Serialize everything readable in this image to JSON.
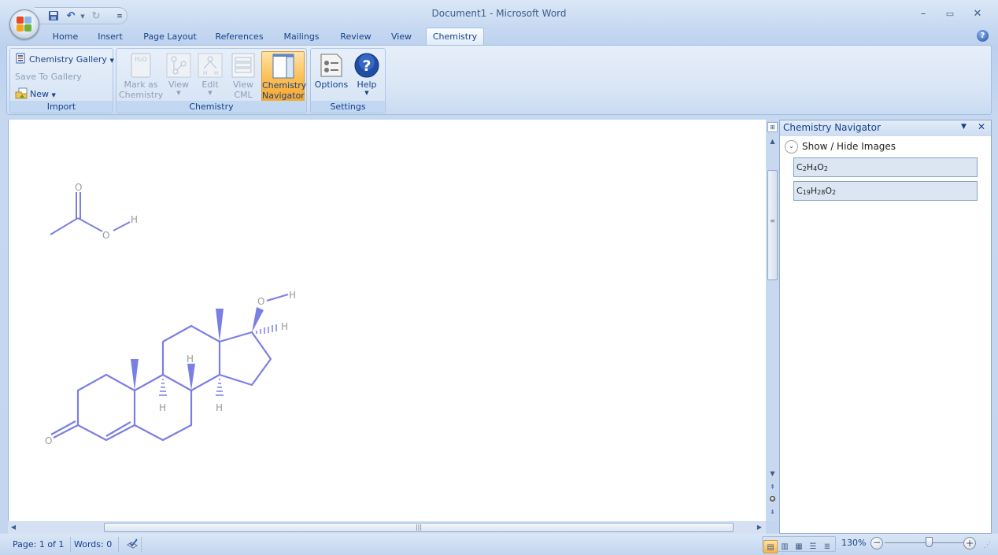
{
  "window": {
    "title": "Document1 - Microsoft Word",
    "controls": {
      "minimize": "–",
      "maximize": "▭",
      "close": "✕"
    }
  },
  "quick_access": {
    "save_icon": "save-icon",
    "undo_icon": "undo-icon",
    "redo_icon": "redo-icon",
    "customize_icon": "customize-icon"
  },
  "tabs": [
    {
      "label": "Home",
      "active": false
    },
    {
      "label": "Insert",
      "active": false
    },
    {
      "label": "Page Layout",
      "active": false
    },
    {
      "label": "References",
      "active": false
    },
    {
      "label": "Mailings",
      "active": false
    },
    {
      "label": "Review",
      "active": false
    },
    {
      "label": "View",
      "active": false
    },
    {
      "label": "Chemistry",
      "active": true
    }
  ],
  "ribbon": {
    "groups": {
      "import": {
        "label": "Import",
        "chemistry_gallery": "Chemistry Gallery",
        "save_to_gallery": "Save To Gallery",
        "new": "New"
      },
      "chemistry": {
        "label": "Chemistry",
        "mark_as": "Mark as",
        "mark_as_2": "Chemistry",
        "view": "View",
        "edit": "Edit",
        "view_cml": "View",
        "view_cml_2": "CML",
        "navigator": "Chemistry",
        "navigator_2": "Navigator"
      },
      "settings": {
        "label": "Settings",
        "options": "Options",
        "help": "Help"
      }
    },
    "help_icon": "?"
  },
  "document": {
    "molecules": [
      {
        "name": "acetic-acid",
        "formula": "C2H4O2",
        "atom_labels": [
          "O",
          "O",
          "H"
        ]
      },
      {
        "name": "testosterone",
        "formula": "C19H28O2",
        "atom_labels": [
          "O",
          "H",
          "H",
          "O",
          "H",
          "H",
          "H"
        ]
      }
    ],
    "bond_color": "#7b7fe3",
    "label_color": "#9a9a9a"
  },
  "task_pane": {
    "title": "Chemistry Navigator",
    "show_hide": "Show / Hide Images",
    "formulas": [
      {
        "parts": [
          [
            "C",
            ""
          ],
          [
            "",
            "2"
          ],
          [
            "H",
            ""
          ],
          [
            "",
            "4"
          ],
          [
            "O",
            ""
          ],
          [
            "",
            "2"
          ]
        ]
      },
      {
        "parts": [
          [
            "C",
            ""
          ],
          [
            "",
            "19"
          ],
          [
            "H",
            ""
          ],
          [
            "",
            "28"
          ],
          [
            "O",
            ""
          ],
          [
            "",
            "2"
          ]
        ]
      }
    ],
    "formula_text": [
      "C",
      "2",
      "H",
      "4",
      "O",
      "2",
      "C",
      "19",
      "H",
      "28",
      "O",
      "2"
    ]
  },
  "status": {
    "page": "Page: 1 of 1",
    "words": "Words: 0",
    "zoom": "130%",
    "zoom_fraction": 0.56
  }
}
